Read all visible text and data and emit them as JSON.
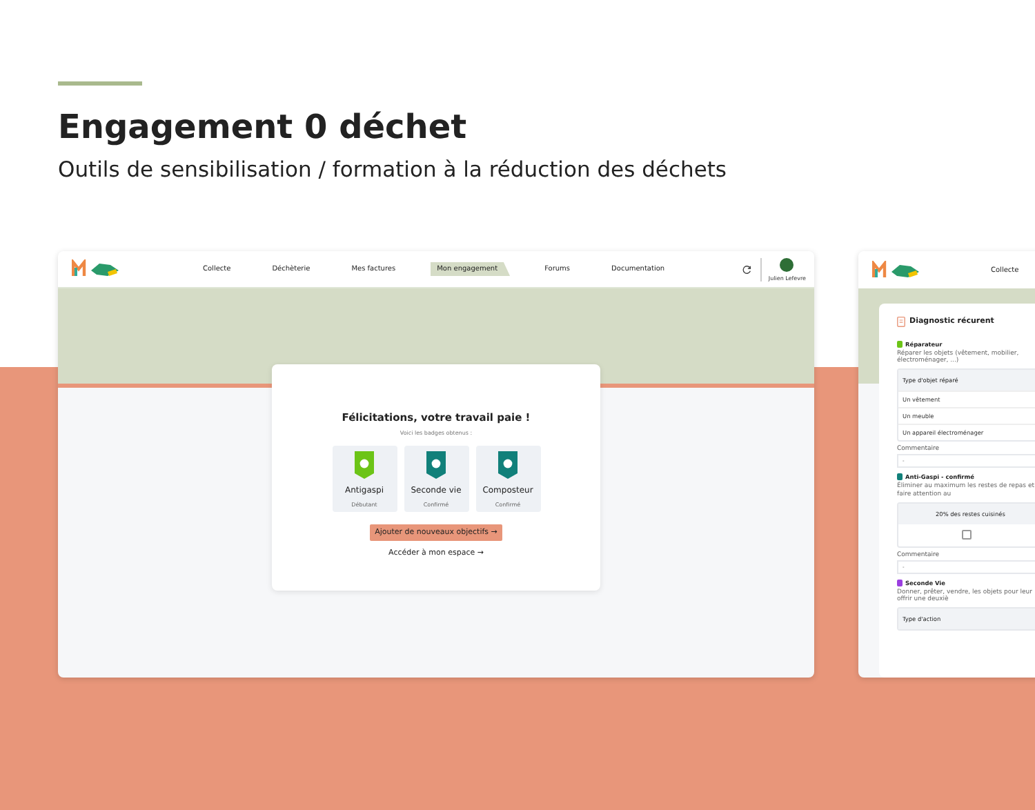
{
  "header": {
    "title": "Engagement 0 déchet",
    "subtitle": "Outils de sensibilisation / formation à la réduction des déchets"
  },
  "screen_1": {
    "nav": [
      {
        "label": "Collecte",
        "selected": false
      },
      {
        "label": "Déchèterie",
        "selected": false
      },
      {
        "label": "Mes factures",
        "selected": false
      },
      {
        "label": "Mon engagement",
        "selected": true
      },
      {
        "label": "Forums",
        "selected": false
      },
      {
        "label": "Documentation",
        "selected": false
      }
    ],
    "user": "Julien Lefevre",
    "modal": {
      "title": "Félicitations, votre travail paie !",
      "subtitle": "Voici les badges obtenus :",
      "badges": [
        {
          "name": "Antigaspi",
          "level": "Débutant",
          "color": "#6cc417"
        },
        {
          "name": "Seconde vie",
          "level": "Confirmé",
          "color": "#11807a"
        },
        {
          "name": "Composteur",
          "level": "Confirmé",
          "color": "#11807a"
        }
      ],
      "button": "Ajouter de nouveaux objectifs →",
      "link": "Accéder à mon espace →"
    }
  },
  "screen_2": {
    "nav": [
      {
        "label": "Collecte",
        "selected": false
      }
    ],
    "panel_title": "Diagnostic récurent",
    "sections": [
      {
        "kind": "table",
        "title": "Réparateur",
        "color": "#6cc417",
        "description": "Réparer les objets (vêtement, mobilier, électroménager, ...)",
        "header": "Type d'objet réparé",
        "rows": [
          "Un vêtement",
          "Un meuble",
          "Un appareil électroménager"
        ],
        "comment_label": "Commentaire",
        "comment": "-"
      },
      {
        "kind": "check",
        "title": "Anti-Gaspi - confirmé",
        "color": "#11807a",
        "description": "Éliminer au maximum les restes de repas et faire attention au",
        "goal": "20% des restes cuisinés",
        "checked": false,
        "comment_label": "Commentaire",
        "comment": "-"
      },
      {
        "kind": "table",
        "title": "Seconde Vie",
        "color": "#9b3fe0",
        "description": "Donner, prêter, vendre, les objets pour leur offrir une deuxiè",
        "header": "Type d'action"
      }
    ]
  }
}
